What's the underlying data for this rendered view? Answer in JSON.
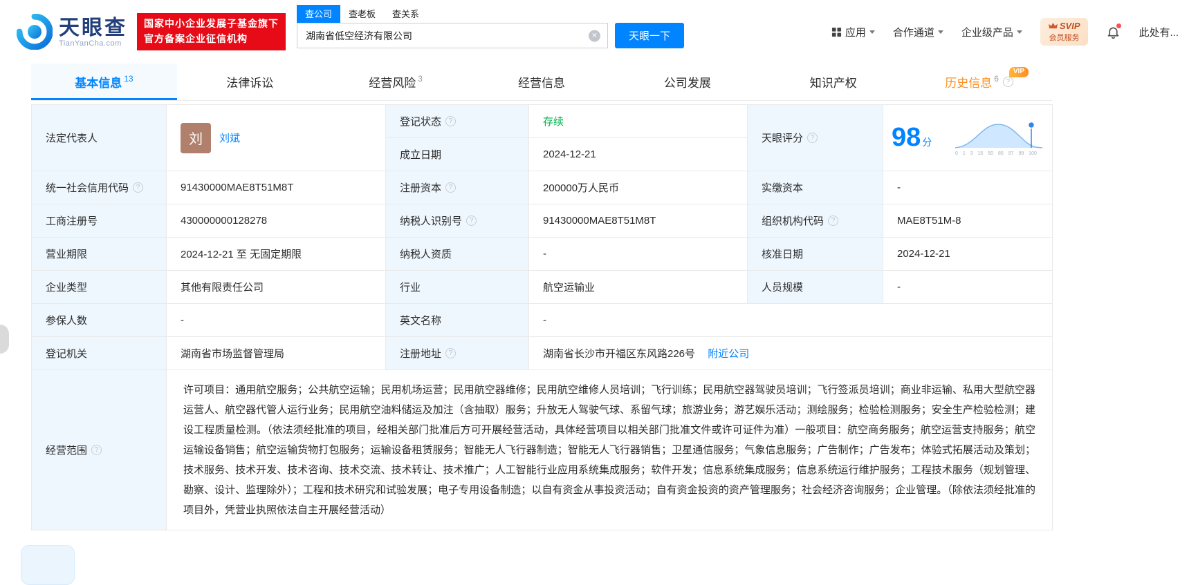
{
  "header": {
    "brand": {
      "cn": "天眼查",
      "en": "TianYanCha.com"
    },
    "cert_badge": {
      "line1": "国家中小企业发展子基金旗下",
      "line2": "官方备案企业征信机构"
    },
    "search_tabs": [
      {
        "label": "查公司"
      },
      {
        "label": "查老板"
      },
      {
        "label": "查关系"
      }
    ],
    "search": {
      "value": "湖南省低空经济有限公司",
      "button_label": "天眼一下"
    },
    "nav_items": [
      {
        "label": "应用"
      },
      {
        "label": "合作通道"
      },
      {
        "label": "企业级产品"
      }
    ],
    "vip_badge": {
      "title": "SVIP",
      "subtitle": "会员服务"
    },
    "notice_text": "此处有..."
  },
  "tabs": {
    "basic": {
      "label": "基本信息",
      "count": "13"
    },
    "legal": {
      "label": "法律诉讼"
    },
    "risk": {
      "label": "经营风险",
      "count": "3"
    },
    "operation": {
      "label": "经营信息"
    },
    "development": {
      "label": "公司发展"
    },
    "ip": {
      "label": "知识产权"
    },
    "history": {
      "label": "历史信息",
      "count": "6",
      "vip_tag": "VIP"
    }
  },
  "info": {
    "legal_rep": {
      "label": "法定代表人",
      "avatar_char": "刘",
      "name": "刘斌"
    },
    "reg_status": {
      "label": "登记状态",
      "value": "存续"
    },
    "establish_date": {
      "label": "成立日期",
      "value": "2024-12-21"
    },
    "score": {
      "label": "天眼评分",
      "value": "98",
      "unit": "分",
      "axis_labels": "0 1 3 15 50 85 97 99 100"
    },
    "credit_code": {
      "label": "统一社会信用代码",
      "value": "91430000MAE8T51M8T"
    },
    "reg_capital": {
      "label": "注册资本",
      "value": "200000万人民币"
    },
    "paid_capital": {
      "label": "实缴资本",
      "value": "-"
    },
    "reg_number": {
      "label": "工商注册号",
      "value": "430000000128278"
    },
    "taxpayer_id": {
      "label": "纳税人识别号",
      "value": "91430000MAE8T51M8T"
    },
    "org_code": {
      "label": "组织机构代码",
      "value": "MAE8T51M-8"
    },
    "business_term": {
      "label": "营业期限",
      "value": "2024-12-21 至 无固定期限"
    },
    "taxpayer_quality": {
      "label": "纳税人资质",
      "value": "-"
    },
    "approval_date": {
      "label": "核准日期",
      "value": "2024-12-21"
    },
    "company_type": {
      "label": "企业类型",
      "value": "其他有限责任公司"
    },
    "industry": {
      "label": "行业",
      "value": "航空运输业"
    },
    "staff_size": {
      "label": "人员规模",
      "value": "-"
    },
    "insured_count": {
      "label": "参保人数",
      "value": "-"
    },
    "english_name": {
      "label": "英文名称",
      "value": "-"
    },
    "reg_authority": {
      "label": "登记机关",
      "value": "湖南省市场监督管理局"
    },
    "reg_address": {
      "label": "注册地址",
      "value": "湖南省长沙市开福区东风路226号",
      "link": "附近公司"
    },
    "business_scope": {
      "label": "经营范围",
      "value": "许可项目：通用航空服务；公共航空运输；民用机场运营；民用航空器维修；民用航空维修人员培训；飞行训练；民用航空器驾驶员培训；飞行签派员培训；商业非运输、私用大型航空器运营人、航空器代管人运行业务；民用航空油料储运及加注（含抽取）服务；升放无人驾驶气球、系留气球；旅游业务；游艺娱乐活动；测绘服务；检验检测服务；安全生产检验检测；建设工程质量检测。（依法须经批准的项目，经相关部门批准后方可开展经营活动，具体经营项目以相关部门批准文件或许可证件为准）一般项目：航空商务服务；航空运营支持服务；航空运输设备销售；航空运输货物打包服务；运输设备租赁服务；智能无人飞行器制造；智能无人飞行器销售；卫星通信服务；气象信息服务；广告制作；广告发布；体验式拓展活动及策划；技术服务、技术开发、技术咨询、技术交流、技术转让、技术推广；人工智能行业应用系统集成服务；软件开发；信息系统集成服务；信息系统运行维护服务；工程技术服务（规划管理、勘察、设计、监理除外）；工程和技术研究和试验发展；电子专用设备制造；以自有资金从事投资活动；自有资金投资的资产管理服务；社会经济咨询服务；企业管理。（除依法须经批准的项目外，凭营业执照依法自主开展经营活动）"
    }
  }
}
